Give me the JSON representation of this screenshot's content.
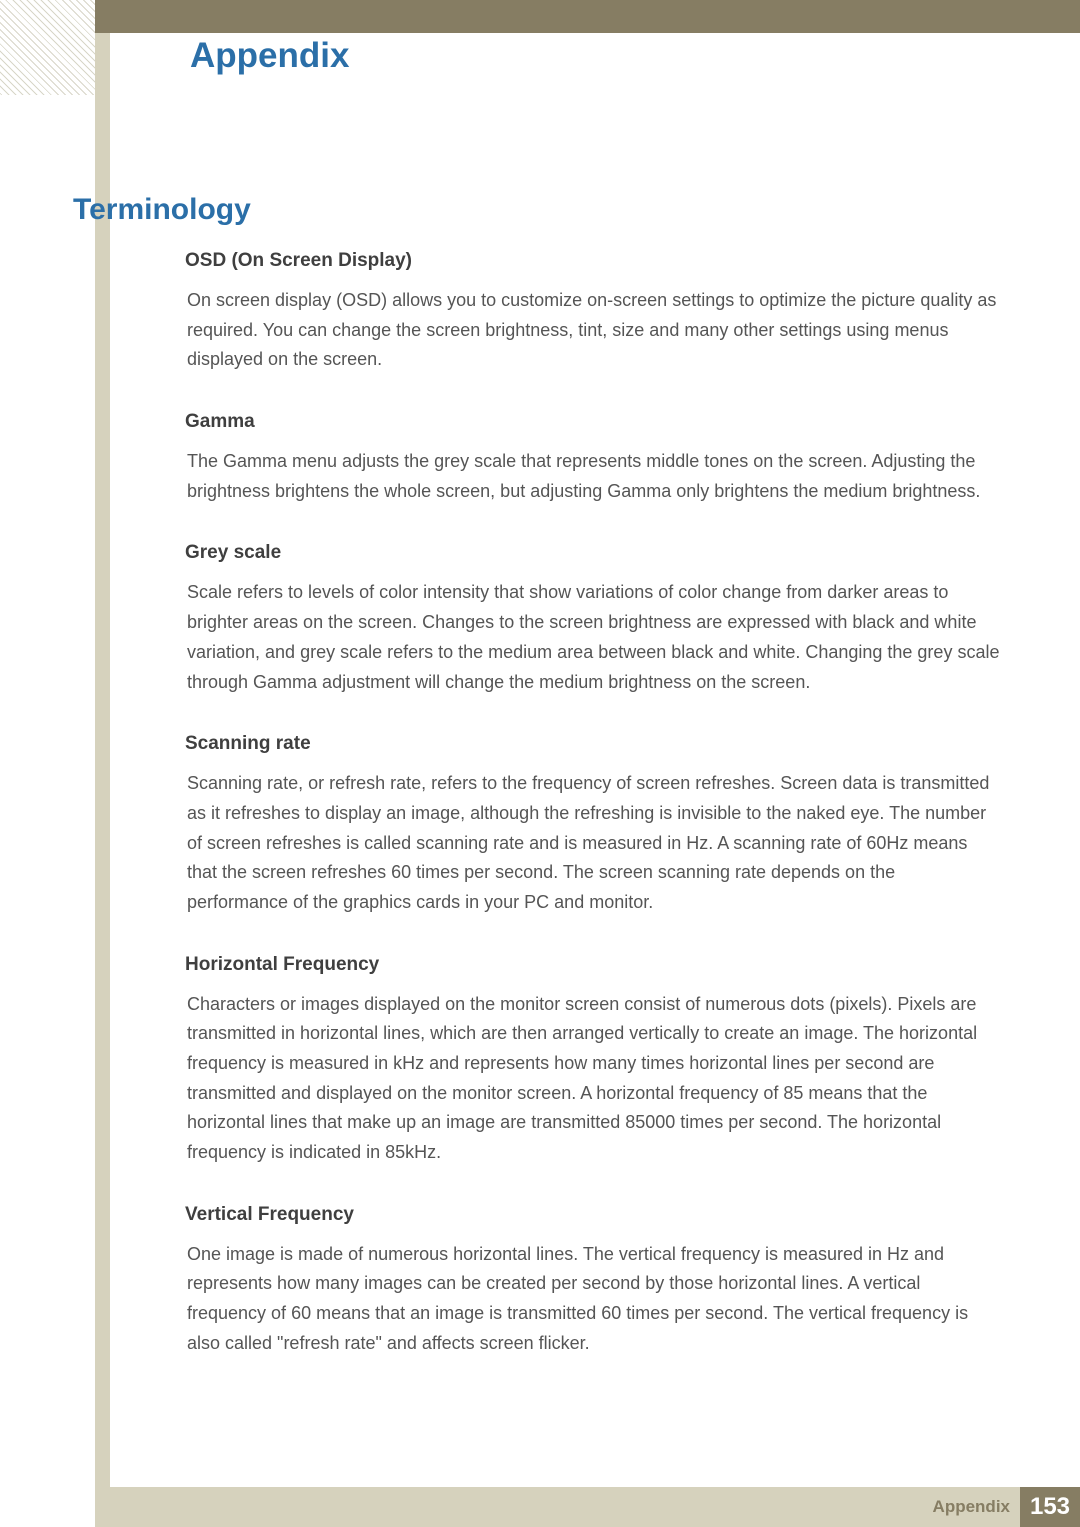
{
  "header": {
    "title": "Appendix"
  },
  "section": {
    "title": "Terminology"
  },
  "terms": [
    {
      "title": "OSD (On Screen Display)",
      "body": "On screen display (OSD) allows you to customize on-screen settings to optimize the picture quality as required. You can change the screen brightness, tint, size and many other settings using menus displayed on the screen."
    },
    {
      "title": "Gamma",
      "body": "The Gamma menu adjusts the grey scale that represents middle tones on the screen. Adjusting the brightness brightens the whole screen, but adjusting Gamma only brightens the medium brightness."
    },
    {
      "title": "Grey scale",
      "body": "Scale refers to levels of color intensity that show variations of color change from darker areas to brighter areas on the screen. Changes to the screen brightness are expressed with black and white variation, and grey scale refers to the medium area between black and white. Changing the grey scale through Gamma adjustment will change the medium brightness on the screen."
    },
    {
      "title": "Scanning rate",
      "body": "Scanning rate, or refresh rate, refers to the frequency of screen refreshes. Screen data is transmitted as it refreshes to display an image, although the refreshing is invisible to the naked eye. The number of screen refreshes is called scanning rate and is measured in Hz. A scanning rate of 60Hz means that the screen refreshes 60 times per second. The screen scanning rate depends on the performance of the graphics cards in your PC and monitor."
    },
    {
      "title": "Horizontal Frequency",
      "body": "Characters or images displayed on the monitor screen consist of numerous dots (pixels). Pixels are transmitted in horizontal lines, which are then arranged vertically to create an image. The horizontal frequency is measured in kHz and represents how many times horizontal lines per second are transmitted and displayed on the monitor screen. A horizontal frequency of 85 means that the horizontal lines that make up an image are transmitted 85000 times per second. The horizontal frequency is indicated in 85kHz."
    },
    {
      "title": "Vertical Frequency",
      "body": "One image is made of numerous horizontal lines. The vertical frequency is measured in Hz and represents how many images can be created per second by those horizontal lines. A vertical frequency of 60 means that an image is transmitted 60 times per second. The vertical frequency is also called \"refresh rate\" and affects screen flicker."
    }
  ],
  "footer": {
    "label": "Appendix",
    "page": "153"
  }
}
